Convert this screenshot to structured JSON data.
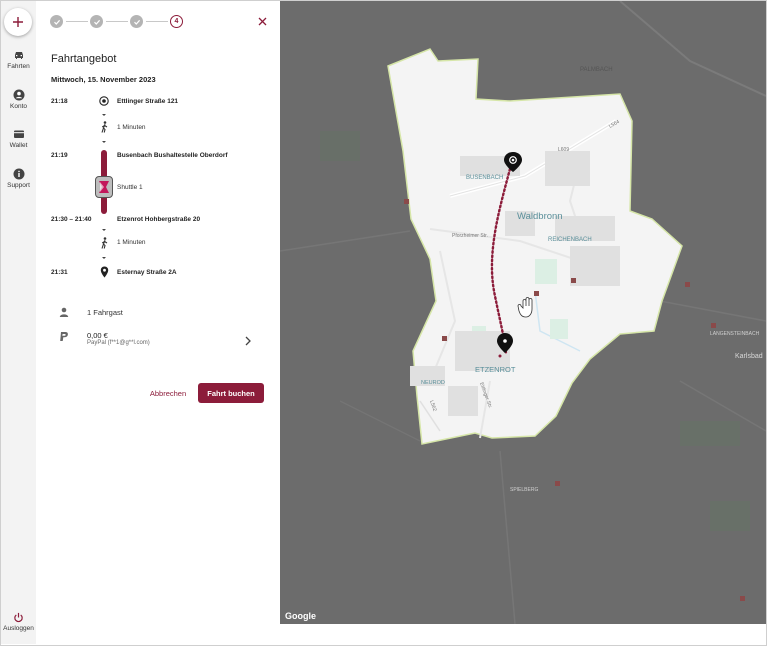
{
  "nav": {
    "add_label": "+",
    "items": [
      {
        "label": "Fahrten",
        "icon": "car-icon"
      },
      {
        "label": "Konto",
        "icon": "account-icon"
      },
      {
        "label": "Wallet",
        "icon": "wallet-icon"
      },
      {
        "label": "Support",
        "icon": "info-icon"
      }
    ],
    "logout_label": "Ausloggen"
  },
  "stepper": {
    "steps": [
      {
        "state": "done"
      },
      {
        "state": "done"
      },
      {
        "state": "done"
      },
      {
        "state": "current",
        "label": "4"
      }
    ]
  },
  "trip": {
    "title": "Fahrtangebot",
    "date": "Mittwoch, 15. November 2023",
    "stops": [
      {
        "time": "21:18",
        "name": "Ettlinger Straße 121"
      },
      {
        "time": "21:19",
        "name": "Busenbach Bushaltestelle Oberdorf"
      },
      {
        "time": "21:30 – 21:40",
        "name": "Etzenrot Hohbergstraße 20"
      },
      {
        "time": "21:31",
        "name": "Esternay Straße 2A"
      }
    ],
    "legs": [
      {
        "type": "walk",
        "label": "1 Minuten"
      },
      {
        "type": "shuttle",
        "label": "Shuttle 1"
      },
      {
        "type": "walk",
        "label": "1 Minuten"
      }
    ]
  },
  "booking": {
    "passengers": "1 Fahrgast",
    "price": "0,00 €",
    "payment_method": "PayPal (f**1@g**l.com)",
    "cancel_label": "Abbrechen",
    "book_label": "Fahrt buchen"
  },
  "map": {
    "attribution": "Google",
    "labels": [
      "PALMBACH",
      "BUSENBACH",
      "Waldbronn",
      "REICHENBACH",
      "ETZENROT",
      "NEUROD",
      "Karlsbad",
      "LANGENSTEINBACH",
      "SPIELBERG",
      "L564",
      "L562",
      "L609",
      "Pforzheimer Str.",
      "Ettlinger Str."
    ],
    "colors": {
      "route": "#8c1c3a",
      "service_area": "#f5f5f5",
      "outside": "#6c6c6c"
    }
  }
}
